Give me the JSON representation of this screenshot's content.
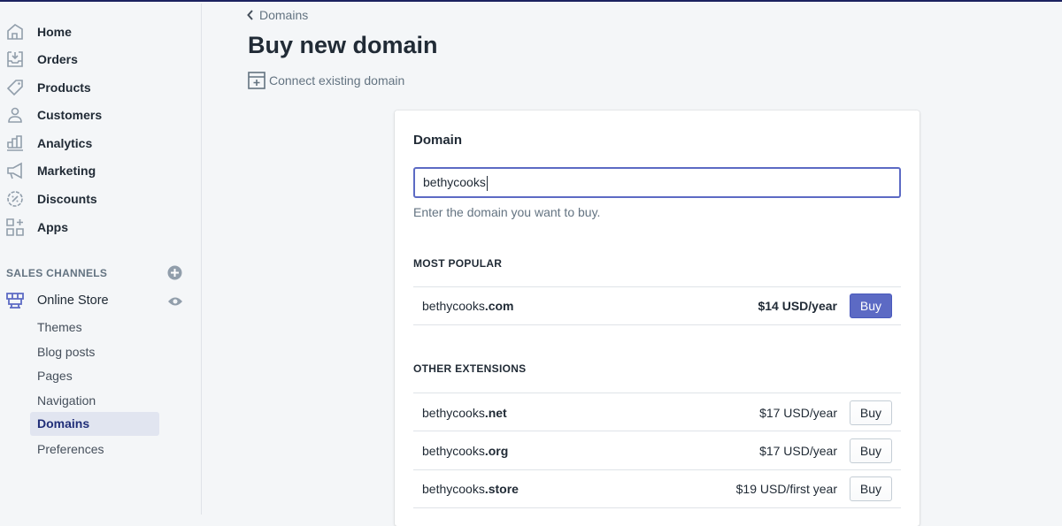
{
  "sidebar": {
    "items": [
      {
        "label": "Home",
        "icon": "home-icon"
      },
      {
        "label": "Orders",
        "icon": "orders-icon"
      },
      {
        "label": "Products",
        "icon": "tag-icon"
      },
      {
        "label": "Customers",
        "icon": "person-icon"
      },
      {
        "label": "Analytics",
        "icon": "bar-chart-icon"
      },
      {
        "label": "Marketing",
        "icon": "megaphone-icon"
      },
      {
        "label": "Discounts",
        "icon": "discount-icon"
      },
      {
        "label": "Apps",
        "icon": "apps-icon"
      }
    ],
    "sales_channels_label": "SALES CHANNELS",
    "online_store": "Online Store",
    "subitems": [
      "Themes",
      "Blog posts",
      "Pages",
      "Navigation",
      "Domains",
      "Preferences"
    ],
    "active_subitem": "Domains"
  },
  "header": {
    "back": "Domains",
    "title": "Buy new domain",
    "connect": "Connect existing domain"
  },
  "card": {
    "title": "Domain",
    "input_value": "bethycooks",
    "help": "Enter the domain you want to buy.",
    "most_popular_label": "MOST POPULAR",
    "most_popular": {
      "base": "bethycooks",
      "ext": ".com",
      "price": "$14 USD/year",
      "button": "Buy"
    },
    "other_label": "OTHER EXTENSIONS",
    "others": [
      {
        "base": "bethycooks",
        "ext": ".net",
        "price": "$17 USD/year",
        "button": "Buy"
      },
      {
        "base": "bethycooks",
        "ext": ".org",
        "price": "$17 USD/year",
        "button": "Buy"
      },
      {
        "base": "bethycooks",
        "ext": ".store",
        "price": "$19 USD/first year",
        "button": "Buy"
      }
    ]
  },
  "colors": {
    "accent": "#5c6ac4",
    "top_bar": "#1c2260",
    "active_bg": "#e1e5f0"
  }
}
